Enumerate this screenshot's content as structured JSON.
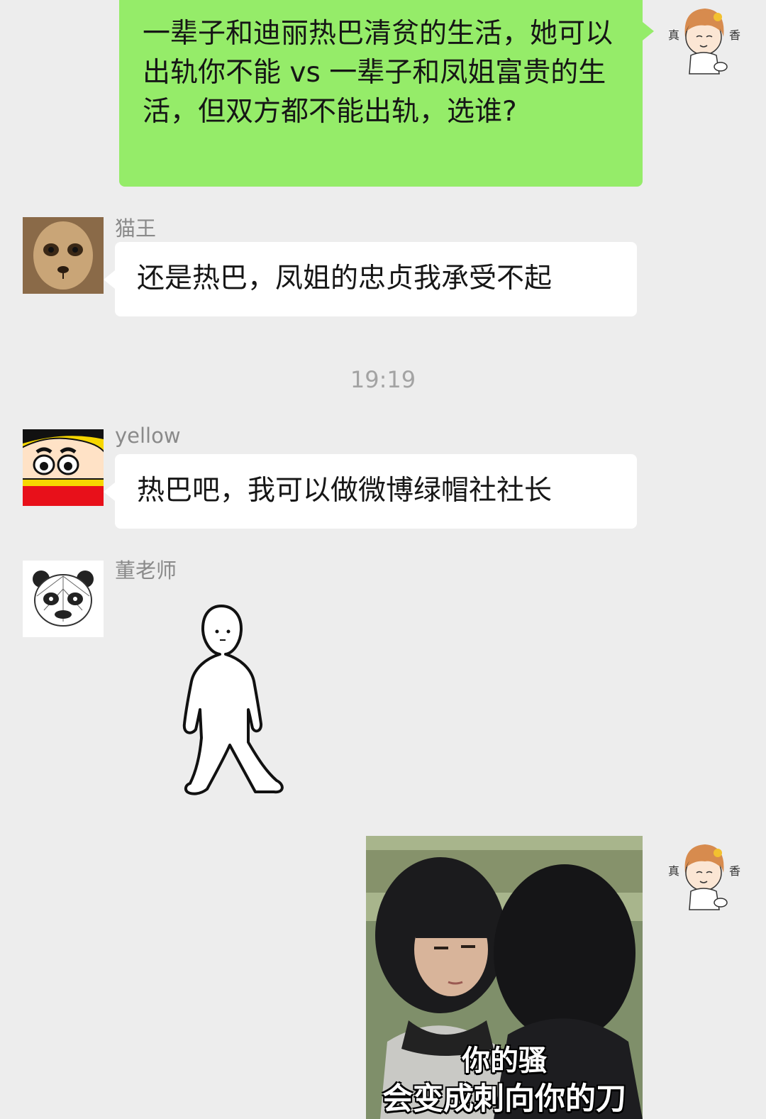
{
  "messages": [
    {
      "sender": "me",
      "avatar": "cartoon-girl-avatar",
      "text": "一辈子和迪丽热巴清贫的生活，她可以出轨你不能 vs 一辈子和凤姐富贵的生活，但双方都不能出轨，选谁?"
    },
    {
      "sender": "猫王",
      "avatar": "meerkat-avatar",
      "text": "还是热巴，凤姐的忠贞我承受不起"
    },
    {
      "time": "19:19"
    },
    {
      "sender": "yellow",
      "avatar": "crayon-shinchan-avatar",
      "text": "热巴吧，我可以做微博绿帽社社长"
    },
    {
      "sender": "董老师",
      "avatar": "panda-avatar",
      "sticker": "standing-stick-figure-sticker"
    },
    {
      "sender": "me",
      "avatar": "cartoon-girl-avatar",
      "sticker": "meme-photo-sticker",
      "caption_lines": [
        "你的骚",
        "会变成刺向你的刀"
      ]
    }
  ],
  "avatar_glyphs": {
    "left": "真",
    "right": "香"
  },
  "colors": {
    "background": "#ededed",
    "my_bubble": "#95ec69",
    "their_bubble": "#ffffff",
    "sender_name": "#8a8a8a",
    "timestamp": "#a3a3a3"
  }
}
